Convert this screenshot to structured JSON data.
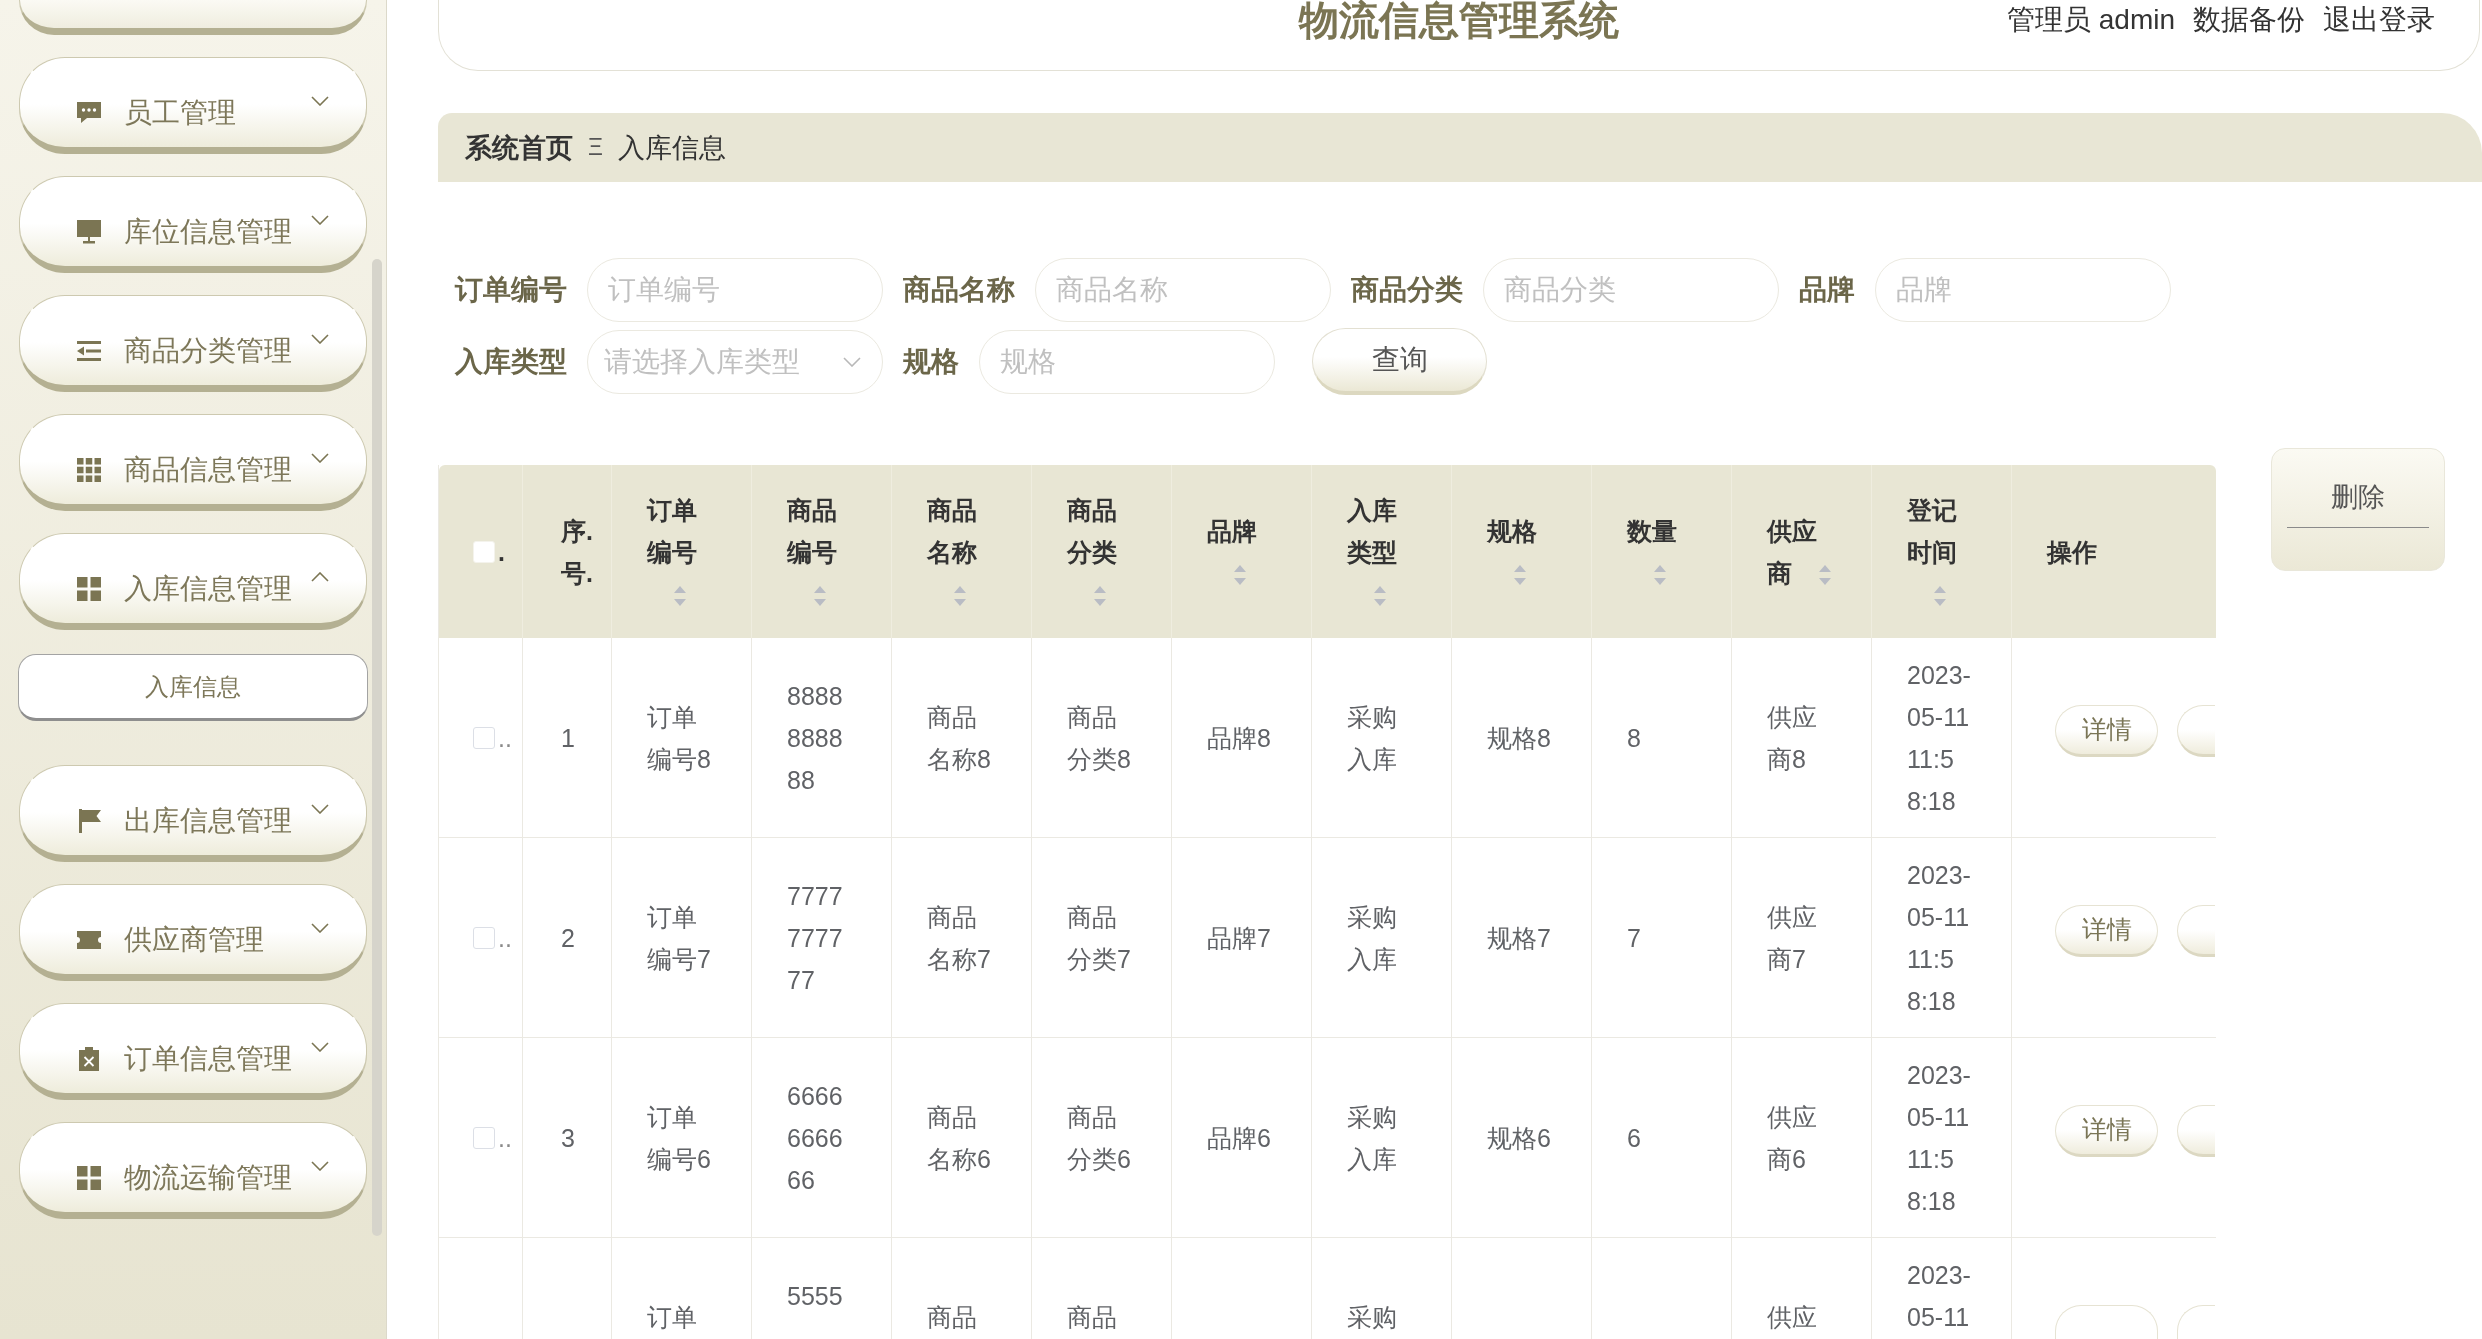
{
  "sidebar": {
    "partly_hidden_item": true,
    "items": [
      {
        "label": "员工管理",
        "expanded": false
      },
      {
        "label": "库位信息管理",
        "expanded": false
      },
      {
        "label": "商品分类管理",
        "expanded": false
      },
      {
        "label": "商品信息管理",
        "expanded": false
      },
      {
        "label": "入库信息管理",
        "expanded": true,
        "children": [
          {
            "label": "入库信息",
            "selected": true
          }
        ]
      },
      {
        "label": "出库信息管理",
        "expanded": false
      },
      {
        "label": "供应商管理",
        "expanded": false
      },
      {
        "label": "订单信息管理",
        "expanded": false
      },
      {
        "label": "物流运输管理",
        "expanded": false
      }
    ]
  },
  "header": {
    "title": "物流信息管理系统",
    "user": "管理员 admin",
    "links": [
      {
        "label": "数据备份"
      },
      {
        "label": "退出登录"
      }
    ]
  },
  "breadcrumb": {
    "items": [
      "系统首页",
      "入库信息"
    ],
    "separator": "Ξ"
  },
  "search": {
    "fields": [
      {
        "kind": "text",
        "label": "订单编号",
        "placeholder": "订单编号"
      },
      {
        "kind": "text",
        "label": "商品名称",
        "placeholder": "商品名称"
      },
      {
        "kind": "text",
        "label": "商品分类",
        "placeholder": "商品分类"
      },
      {
        "kind": "text",
        "label": "品牌",
        "placeholder": "品牌"
      },
      {
        "kind": "select",
        "label": "入库类型",
        "placeholder": "请选择入库类型"
      },
      {
        "kind": "text",
        "label": "规格",
        "placeholder": "规格"
      }
    ],
    "button": "查询"
  },
  "delete_button": "删除",
  "table": {
    "select_all": {
      "checked": false,
      "overflow": "."
    },
    "columns": [
      {
        "label": "序.号.",
        "sortable": false
      },
      {
        "label": "订单编号",
        "sortable": true
      },
      {
        "label": "商品编号",
        "sortable": true
      },
      {
        "label": "商品名称",
        "sortable": true
      },
      {
        "label": "商品分类",
        "sortable": true
      },
      {
        "label": "品牌",
        "sortable": true
      },
      {
        "label": "入库类型",
        "sortable": true
      },
      {
        "label": "规格",
        "sortable": true
      },
      {
        "label": "数量",
        "sortable": true
      },
      {
        "label": "供应商",
        "sortable": true
      },
      {
        "label": "登记时间",
        "sortable": true
      },
      {
        "label": "操作",
        "sortable": false
      }
    ],
    "rows": [
      {
        "selected": false,
        "overflow": "..",
        "index": "1",
        "order_no": "订单编号8",
        "product_no": "8888888888",
        "product_name": "商品名称8",
        "category": "商品分类8",
        "brand": "品牌8",
        "type": "采购入库",
        "spec": "规格8",
        "quantity": "8",
        "supplier": "供应商8",
        "registered": "2023-05-11 11:58:18",
        "actions": [
          {
            "kind": "button",
            "label": "详情"
          },
          {
            "kind": "edge"
          }
        ]
      },
      {
        "selected": false,
        "overflow": "..",
        "index": "2",
        "order_no": "订单编号7",
        "product_no": "7777777777",
        "product_name": "商品名称7",
        "category": "商品分类7",
        "brand": "品牌7",
        "type": "采购入库",
        "spec": "规格7",
        "quantity": "7",
        "supplier": "供应商7",
        "registered": "2023-05-11 11:58:18",
        "actions": [
          {
            "kind": "button",
            "label": "详情"
          },
          {
            "kind": "edge"
          }
        ]
      },
      {
        "selected": false,
        "overflow": "..",
        "index": "3",
        "order_no": "订单编号6",
        "product_no": "6666666666",
        "product_name": "商品名称6",
        "category": "商品分类6",
        "brand": "品牌6",
        "type": "采购入库",
        "spec": "规格6",
        "quantity": "6",
        "supplier": "供应商6",
        "registered": "2023-05-11 11:58:18",
        "actions": [
          {
            "kind": "button",
            "label": "详情"
          },
          {
            "kind": "edge"
          }
        ]
      }
    ],
    "cut_row": {
      "order_no": "订单",
      "product_no": "5555",
      "product_name": "商品",
      "category": "商品",
      "type": "采购",
      "supplier": "供应",
      "registered": "2023-05-11",
      "actions": [
        {
          "kind": "button_top"
        },
        {
          "kind": "edge_top"
        }
      ]
    }
  }
}
